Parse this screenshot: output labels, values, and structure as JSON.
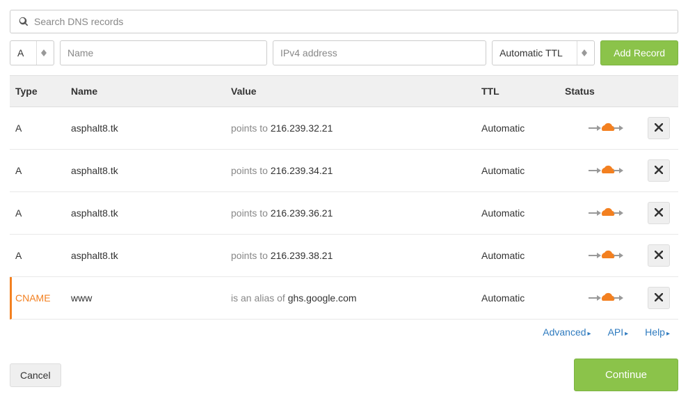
{
  "search": {
    "placeholder": "Search DNS records"
  },
  "add_form": {
    "type_value": "A",
    "name_placeholder": "Name",
    "value_placeholder": "IPv4 address",
    "ttl_value": "Automatic TTL",
    "add_button": "Add Record"
  },
  "table": {
    "headers": {
      "type": "Type",
      "name": "Name",
      "value": "Value",
      "ttl": "TTL",
      "status": "Status"
    },
    "rows": [
      {
        "type": "A",
        "name": "asphalt8.tk",
        "value_prefix": "points to ",
        "value_strong": "216.239.32.21",
        "ttl": "Automatic",
        "proxied": true
      },
      {
        "type": "A",
        "name": "asphalt8.tk",
        "value_prefix": "points to ",
        "value_strong": "216.239.34.21",
        "ttl": "Automatic",
        "proxied": true
      },
      {
        "type": "A",
        "name": "asphalt8.tk",
        "value_prefix": "points to ",
        "value_strong": "216.239.36.21",
        "ttl": "Automatic",
        "proxied": true
      },
      {
        "type": "A",
        "name": "asphalt8.tk",
        "value_prefix": "points to ",
        "value_strong": "216.239.38.21",
        "ttl": "Automatic",
        "proxied": true
      },
      {
        "type": "CNAME",
        "name": "www",
        "value_prefix": "is an alias of ",
        "value_strong": "ghs.google.com",
        "ttl": "Automatic",
        "proxied": true,
        "active": true
      }
    ]
  },
  "footer_links": {
    "advanced": "Advanced",
    "api": "API",
    "help": "Help"
  },
  "buttons": {
    "cancel": "Cancel",
    "continue": "Continue"
  }
}
